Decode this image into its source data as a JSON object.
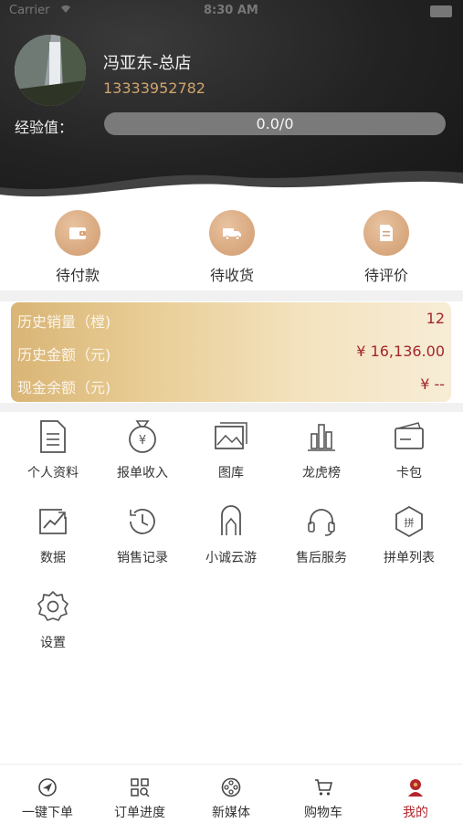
{
  "status_bar": {
    "carrier": "Carrier",
    "time": "8:30 AM"
  },
  "profile": {
    "name": "冯亚东-总店",
    "phone": "13333952782",
    "exp_label": "经验值：",
    "exp_value": "0.0/0"
  },
  "orders": [
    {
      "label": "待付款",
      "icon": "wallet-icon"
    },
    {
      "label": "待收货",
      "icon": "truck-icon"
    },
    {
      "label": "待评价",
      "icon": "document-icon"
    }
  ],
  "stats": [
    {
      "label": "历史销量（樘)",
      "value": "12"
    },
    {
      "label": "历史金额（元)",
      "value": "¥ 16,136.00"
    },
    {
      "label": "现金余额（元)",
      "value": "¥ --"
    }
  ],
  "menu": [
    {
      "label": "个人资料",
      "icon": "profile-doc-icon"
    },
    {
      "label": "报单收入",
      "icon": "money-bag-icon"
    },
    {
      "label": "图库",
      "icon": "gallery-icon"
    },
    {
      "label": "龙虎榜",
      "icon": "ranking-icon"
    },
    {
      "label": "卡包",
      "icon": "card-wallet-icon"
    },
    {
      "label": "数据",
      "icon": "chart-icon"
    },
    {
      "label": "销售记录",
      "icon": "history-icon"
    },
    {
      "label": "小诚云游",
      "icon": "tour-icon"
    },
    {
      "label": "售后服务",
      "icon": "headset-icon"
    },
    {
      "label": "拼单列表",
      "icon": "group-buy-icon"
    },
    {
      "label": "设置",
      "icon": "gear-icon"
    }
  ],
  "tabs": [
    {
      "label": "一键下单",
      "icon": "send-icon"
    },
    {
      "label": "订单进度",
      "icon": "qr-search-icon"
    },
    {
      "label": "新媒体",
      "icon": "film-reel-icon"
    },
    {
      "label": "购物车",
      "icon": "cart-icon"
    },
    {
      "label": "我的",
      "icon": "user-icon"
    }
  ],
  "colors": {
    "accent_red": "#b3262a",
    "gold": "#d9b576",
    "phone_gold": "#d2a46e"
  }
}
